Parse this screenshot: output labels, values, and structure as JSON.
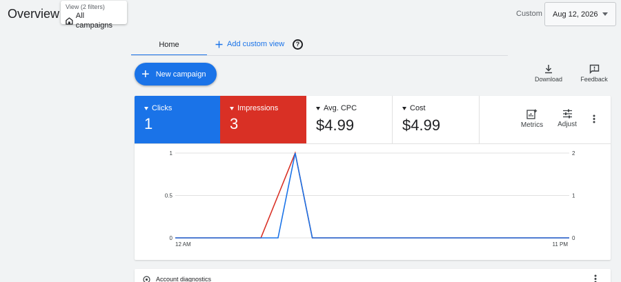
{
  "header": {
    "title": "Overview",
    "view_filters": "View (2 filters)",
    "view_label": "All campaigns",
    "date_range_label": "Custom",
    "date_value": "Aug 12, 2026"
  },
  "tabs": {
    "home": "Home",
    "add_custom_view": "Add custom view"
  },
  "actions": {
    "new_campaign": "New campaign",
    "download": "Download",
    "feedback": "Feedback"
  },
  "metrics": {
    "clicks": {
      "label": "Clicks",
      "value": "1",
      "color": "#1a73e8"
    },
    "impressions": {
      "label": "Impressions",
      "value": "3",
      "color": "#d93025"
    },
    "avg_cpc": {
      "label": "Avg. CPC",
      "value": "$4.99"
    },
    "cost": {
      "label": "Cost",
      "value": "$4.99"
    }
  },
  "card_tools": {
    "metrics": "Metrics",
    "adjust": "Adjust"
  },
  "chart_data": {
    "type": "line",
    "x_ticks": [
      "12 AM",
      "11 PM"
    ],
    "x": [
      0,
      5,
      6,
      7,
      8,
      23
    ],
    "left_axis_ticks": [
      "0",
      "0.5",
      "1"
    ],
    "right_axis_ticks": [
      "0",
      "1",
      "2"
    ],
    "ylim_left": [
      0,
      1
    ],
    "ylim_right": [
      0,
      2
    ],
    "grid": true,
    "series": [
      {
        "color": "#1a73e8",
        "axis": "left",
        "values": [
          0,
          0,
          0,
          1,
          0,
          0
        ]
      },
      {
        "color": "#d93025",
        "axis": "right",
        "values": [
          0,
          0,
          1,
          2,
          0,
          0
        ]
      }
    ]
  },
  "diagnostics": {
    "label": "Account diagnostics"
  }
}
